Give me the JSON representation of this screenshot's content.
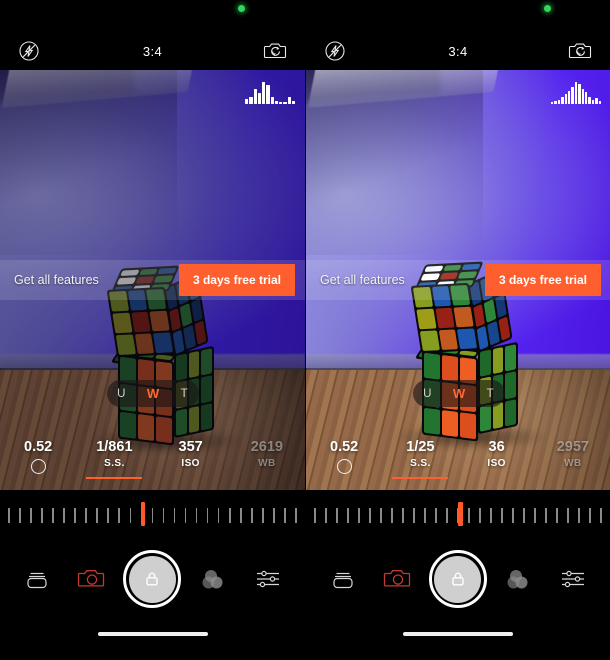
{
  "app": {
    "title": "Manual Camera",
    "screenshot_layout": "side-by-side comparison of two camera viewfinder screenshots"
  },
  "panels": [
    {
      "id": "left",
      "statusbar": {
        "camera_in_use_dot": "green-recording-dot"
      },
      "topbar": {
        "flash_icon": "flash-off-icon",
        "aspect_ratio": "3:4",
        "flip_icon": "camera-flip-icon"
      },
      "viewfinder": {
        "scene_description": "two stacked Rubik's cubes on a wooden floor against a purple-lit wall",
        "histogram": {
          "label": "histogram-icon",
          "bars": [
            22,
            34,
            70,
            48,
            100,
            86,
            30,
            14,
            10,
            8,
            34,
            12
          ]
        }
      },
      "promo": {
        "label": "Get all features",
        "cta_label": "3 days free trial",
        "cta_color": "#ff5f2e"
      },
      "lens_selector": {
        "options": [
          "U",
          "W",
          "T"
        ],
        "selected": "W",
        "active_color": "#ff6a32"
      },
      "readout": [
        {
          "value": "0.52",
          "key": "",
          "icon": "aperture-ring-icon",
          "dim": false,
          "active": false
        },
        {
          "value": "1/861",
          "key": "S.S.",
          "icon": "",
          "dim": false,
          "active": true
        },
        {
          "value": "357",
          "key": "ISO",
          "icon": "",
          "dim": false,
          "active": false
        },
        {
          "value": "2619",
          "key": "WB",
          "icon": "",
          "dim": true,
          "active": false
        }
      ],
      "dial": {
        "tick_count": 27,
        "marker_position_pct": 46,
        "marker_color": "#ff5a28"
      },
      "toolbar": [
        {
          "name": "gallery-stack-icon",
          "label": "Gallery"
        },
        {
          "name": "camera-mode-icon",
          "label": "Photo",
          "color": "#c63a2e"
        },
        {
          "name": "shutter-lock-button",
          "label": "Shutter"
        },
        {
          "name": "filters-icon",
          "label": "Filters"
        },
        {
          "name": "settings-sliders-icon",
          "label": "Settings"
        }
      ]
    },
    {
      "id": "right",
      "statusbar": {
        "camera_in_use_dot": "green-recording-dot"
      },
      "topbar": {
        "flash_icon": "flash-off-icon",
        "aspect_ratio": "3:4",
        "flip_icon": "camera-flip-icon"
      },
      "viewfinder": {
        "scene_description": "same stacked Rubik's cubes scene, brighter exposure",
        "histogram": {
          "label": "histogram-icon",
          "bars": [
            8,
            14,
            20,
            30,
            44,
            60,
            78,
            100,
            92,
            70,
            54,
            30,
            18,
            26,
            12
          ]
        }
      },
      "promo": {
        "label": "Get all features",
        "cta_label": "3 days free trial",
        "cta_color": "#ff5f2e"
      },
      "lens_selector": {
        "options": [
          "U",
          "W",
          "T"
        ],
        "selected": "W",
        "active_color": "#ff6a32"
      },
      "readout": [
        {
          "value": "0.52",
          "key": "",
          "icon": "aperture-ring-icon",
          "dim": false,
          "active": false
        },
        {
          "value": "1/25",
          "key": "S.S.",
          "icon": "",
          "dim": false,
          "active": true
        },
        {
          "value": "36",
          "key": "ISO",
          "icon": "",
          "dim": false,
          "active": false
        },
        {
          "value": "2957",
          "key": "WB",
          "icon": "",
          "dim": true,
          "active": false
        }
      ],
      "dial": {
        "tick_count": 27,
        "marker_position_pct": 50,
        "marker_color": "#ff5a28"
      },
      "toolbar": [
        {
          "name": "gallery-stack-icon",
          "label": "Gallery"
        },
        {
          "name": "camera-mode-icon",
          "label": "Photo",
          "color": "#c63a2e"
        },
        {
          "name": "shutter-lock-button",
          "label": "Shutter"
        },
        {
          "name": "filters-icon",
          "label": "Filters"
        },
        {
          "name": "settings-sliders-icon",
          "label": "Settings"
        }
      ]
    }
  ],
  "cube_colors": {
    "bottom_front": [
      "#1f6a2a",
      "#c9471c",
      "#d8551f",
      "#2a7a33",
      "#d8551f",
      "#c9471c",
      "#1f6a2a",
      "#d8551f",
      "#c9471c"
    ],
    "bottom_side": [
      "#1b5f26",
      "#7a8f1c",
      "#2a7a33",
      "#7a8f1c",
      "#1b5f26",
      "#1b5f26",
      "#2a7a33",
      "#7a8f1c",
      "#1b5f26"
    ],
    "bottom_top": [
      "#2a7a33",
      "#7a8f1c",
      "#1b5f26",
      "#7a8f1c",
      "#2a7a33",
      "#7a8f1c",
      "#1b5f26",
      "#2a7a33",
      "#7a8f1c"
    ],
    "top_front": [
      "#7a8f1c",
      "#1b4fa0",
      "#2a7a33",
      "#8f8f15",
      "#8a1d12",
      "#b0521c",
      "#7a8f1c",
      "#b0521c",
      "#1b4fa0"
    ],
    "top_side": [
      "#12336b",
      "#15407f",
      "#1b4fa0",
      "#8a1d12",
      "#2a7a33",
      "#12336b",
      "#1b4fa0",
      "#15407f",
      "#8a1d12"
    ],
    "top_cap": [
      "#dfe3e8",
      "#2a7a33",
      "#1b4fa0",
      "#e8e8e8",
      "#8a1d12",
      "#2a7a33",
      "#1b4fa0",
      "#dfe3e8",
      "#2a7a33"
    ]
  }
}
